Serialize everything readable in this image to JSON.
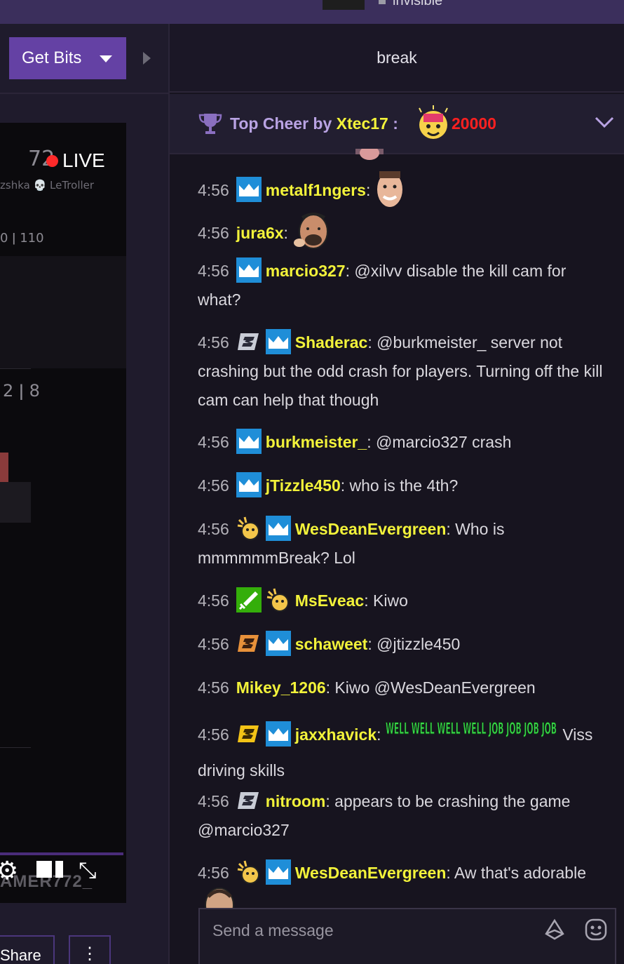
{
  "topbar": {
    "status_text": "invisible"
  },
  "left": {
    "get_bits_label": "Get Bits",
    "player": {
      "viewer_fragment": "72",
      "live_label": "LIVE",
      "hud_names": "zshka 💀 LeTroller",
      "hud_row1": "0 ǀ 110",
      "hud_row2": "2 ǀ 8",
      "streamer_name": "AMER772_"
    },
    "share_label": "Share",
    "more_label": "⋮"
  },
  "chat": {
    "header_title": "break",
    "pinned": {
      "prefix": "Top Cheer by ",
      "name": "Xtec17",
      "suffix": " :",
      "amount": "20000"
    },
    "messages": [
      {
        "time": "4:56",
        "user": "metalf1ngers",
        "text": ""
      },
      {
        "time": "4:56",
        "user": "jura6x",
        "text": ""
      },
      {
        "time": "4:56",
        "user": "marcio327",
        "text": " @xilvv disable the kill cam for what?"
      },
      {
        "time": "4:56",
        "user": "Shaderac",
        "text": " @burkmeister_ server not crashing but the odd crash for players. Turning off the kill cam can help that though"
      },
      {
        "time": "4:56",
        "user": "burkmeister_",
        "text": " @marcio327 crash"
      },
      {
        "time": "4:56",
        "user": "jTizzle450",
        "text": " who is the 4th?"
      },
      {
        "time": "4:56",
        "user": "WesDeanEvergreen",
        "text": " Who is mmmmmmBreak? Lol"
      },
      {
        "time": "4:56",
        "user": "MsEveac",
        "text": " Kiwo"
      },
      {
        "time": "4:56",
        "user": "schaweet",
        "text": " @jtizzle450"
      },
      {
        "time": "4:56",
        "user": "Mikey_1206",
        "text": " Kiwo @WesDeanEvergreen"
      },
      {
        "time": "4:56",
        "user": "jaxxhavick",
        "text": "Viss driving skills",
        "emote_text": "WELL WELL WELL WELL JOB JOB JOB JOB"
      },
      {
        "time": "4:56",
        "user": "nitroom",
        "text": " appears to be crashing the game @marcio327"
      },
      {
        "time": "4:56",
        "user": "WesDeanEvergreen",
        "text": " Aw that's adorable"
      }
    ],
    "input_placeholder": "Send a message"
  },
  "colors": {
    "username": "#f2f23a",
    "accent_purple": "#6441a4",
    "cheer_amount": "#ff2020",
    "live_dot": "#ff2a2a",
    "sub_badge": "#1f8ed8",
    "mod_badge": "#34ae0a"
  }
}
